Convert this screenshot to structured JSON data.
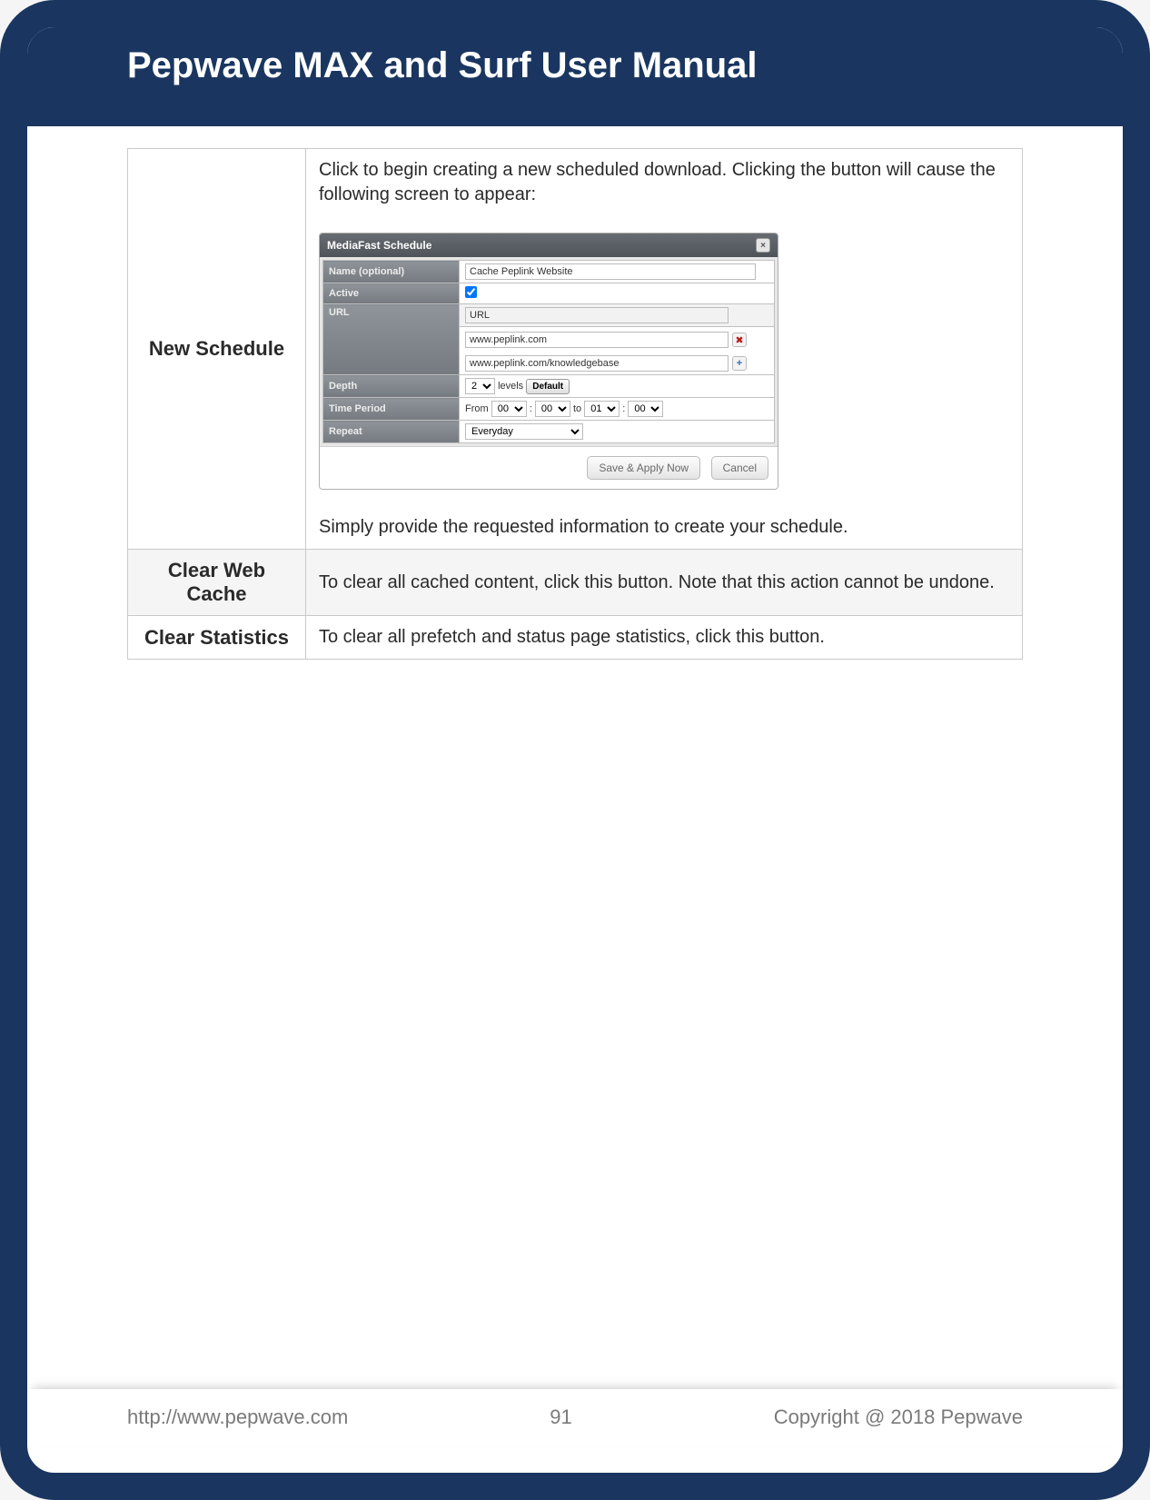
{
  "header": {
    "title": "Pepwave MAX and Surf User Manual"
  },
  "rows": [
    {
      "label": "New Schedule",
      "desc_top": "Click to begin creating a new scheduled download. Clicking the button will cause the following screen to appear:",
      "desc_bottom": "Simply provide the requested information to create your schedule."
    },
    {
      "label": "Clear Web Cache",
      "desc": "To clear all cached content, click this button. Note that this action cannot be undone."
    },
    {
      "label": "Clear Statistics",
      "desc": "To clear all prefetch and status page statistics, click this button."
    }
  ],
  "dialog": {
    "title": "MediaFast Schedule",
    "close": "×",
    "fields": {
      "name_label": "Name (optional)",
      "name_value": "Cache Peplink Website",
      "active_label": "Active",
      "url_label": "URL",
      "url_header": "URL",
      "url1": "www.peplink.com",
      "url2": "www.peplink.com/knowledgebase",
      "depth_label": "Depth",
      "depth_value": "2",
      "depth_levels": "levels",
      "depth_default": "Default",
      "time_label": "Time Period",
      "time_from": "From",
      "time_h1": "00",
      "time_m1": "00",
      "time_to": "to",
      "time_h2": "01",
      "time_m2": "00",
      "repeat_label": "Repeat",
      "repeat_value": "Everyday"
    },
    "footer": {
      "save": "Save & Apply Now",
      "cancel": "Cancel"
    }
  },
  "footer": {
    "url": "http://www.pepwave.com",
    "page": "91",
    "copyright": "Copyright @ 2018 Pepwave"
  }
}
